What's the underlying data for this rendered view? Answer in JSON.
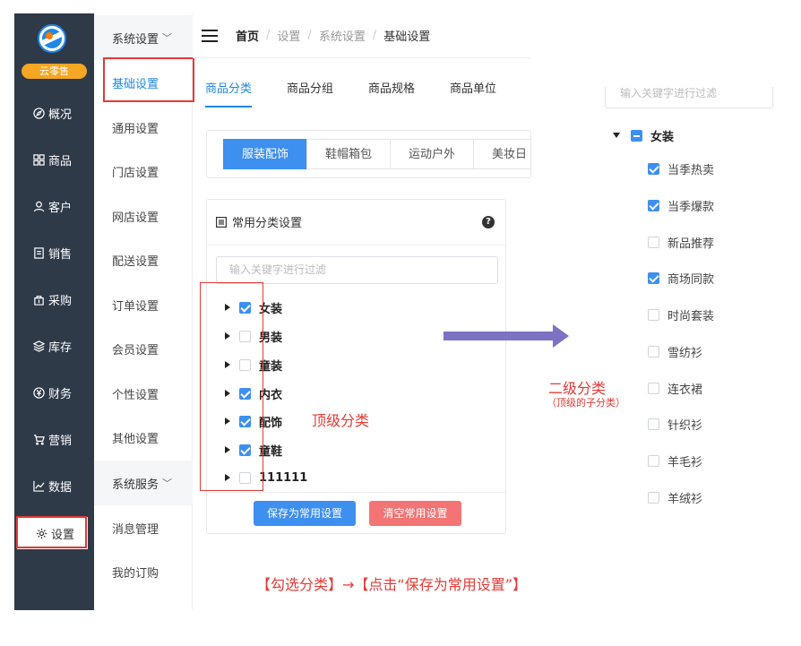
{
  "sidebar": {
    "brand": "云零售",
    "items": [
      {
        "label": "概况",
        "icon": "compass-icon"
      },
      {
        "label": "商品",
        "icon": "grid-icon"
      },
      {
        "label": "客户",
        "icon": "user-icon"
      },
      {
        "label": "销售",
        "icon": "document-icon"
      },
      {
        "label": "采购",
        "icon": "purchase-icon"
      },
      {
        "label": "库存",
        "icon": "stack-icon"
      },
      {
        "label": "财务",
        "icon": "yen-icon"
      },
      {
        "label": "营销",
        "icon": "cart-icon"
      },
      {
        "label": "数据",
        "icon": "chart-icon"
      },
      {
        "label": "设置",
        "icon": "gear-icon"
      }
    ]
  },
  "submenu": {
    "group1": "系统设置",
    "items": [
      "基础设置",
      "通用设置",
      "门店设置",
      "网店设置",
      "配送设置",
      "订单设置",
      "会员设置",
      "个性设置",
      "其他设置"
    ],
    "group2": "系统服务",
    "items2": [
      "消息管理",
      "我的订购"
    ]
  },
  "breadcrumb": {
    "home": "首页",
    "l1": "设置",
    "l2": "系统设置",
    "current": "基础设置",
    "separator": "/"
  },
  "tabs": [
    "商品分类",
    "商品分组",
    "商品规格",
    "商品单位"
  ],
  "categories": [
    "服装配饰",
    "鞋帽箱包",
    "运动户外",
    "美妆日"
  ],
  "panel": {
    "title": "常用分类设置",
    "help": "?",
    "filter_placeholder": "输入关键字进行过滤",
    "items": [
      {
        "label": "女装",
        "checked": true
      },
      {
        "label": "男装",
        "checked": false
      },
      {
        "label": "童装",
        "checked": false
      },
      {
        "label": "内衣",
        "checked": true
      },
      {
        "label": "配饰",
        "checked": true
      },
      {
        "label": "童鞋",
        "checked": true
      },
      {
        "label": "111111",
        "checked": false
      }
    ],
    "save_label": "保存为常用设置",
    "clear_label": "清空常用设置"
  },
  "annotations": {
    "top_level": "顶级分类",
    "second_level": "二级分类",
    "second_level_note": "（顶级的子分类）",
    "instruction": "【勾选分类】→【点击“保存为常用设置”】"
  },
  "right_tree": {
    "filter_placeholder": "输入关键字进行过滤",
    "parent": "女装",
    "children": [
      {
        "label": "当季热卖",
        "checked": true
      },
      {
        "label": "当季爆款",
        "checked": true
      },
      {
        "label": "新品推荐",
        "checked": false
      },
      {
        "label": "商场同款",
        "checked": true
      },
      {
        "label": "时尚套装",
        "checked": false
      },
      {
        "label": "雪纺衫",
        "checked": false
      },
      {
        "label": "连衣裙",
        "checked": false
      },
      {
        "label": "针织衫",
        "checked": false
      },
      {
        "label": "羊毛衫",
        "checked": false
      },
      {
        "label": "羊绒衫",
        "checked": false
      }
    ]
  },
  "colors": {
    "sidebar_bg": "#2f3a49",
    "accent": "#3d8ff0",
    "danger": "#f37474",
    "annotation": "#e53935",
    "arrow": "#7b72c4"
  }
}
